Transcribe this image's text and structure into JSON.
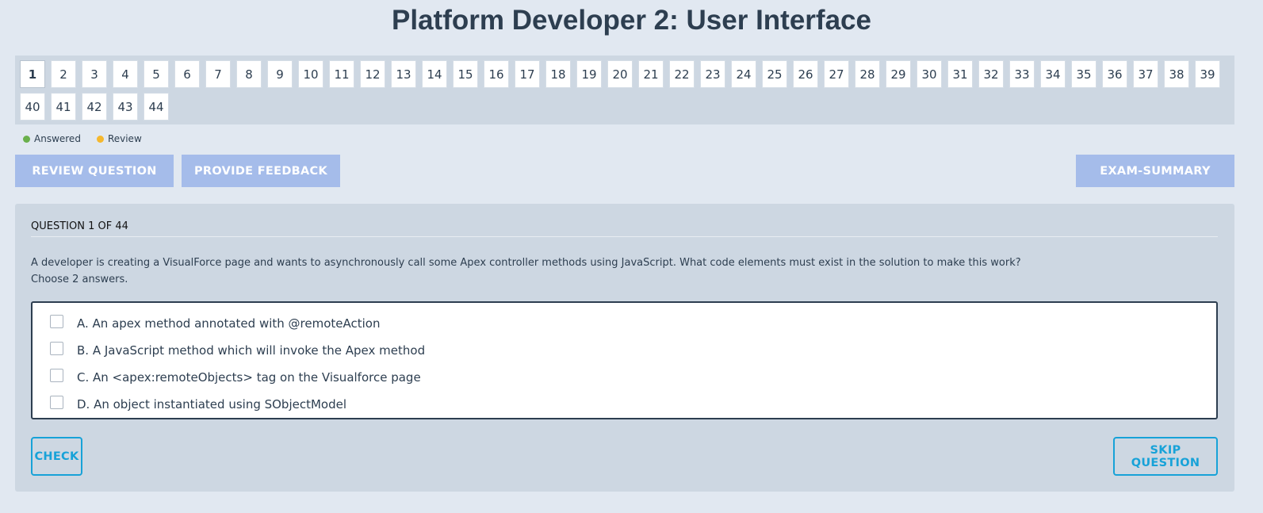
{
  "header": {
    "title": "Platform Developer 2: User Interface"
  },
  "navigation": {
    "current": "1",
    "questions": [
      "1",
      "2",
      "3",
      "4",
      "5",
      "6",
      "7",
      "8",
      "9",
      "10",
      "11",
      "12",
      "13",
      "14",
      "15",
      "16",
      "17",
      "18",
      "19",
      "20",
      "21",
      "22",
      "23",
      "24",
      "25",
      "26",
      "27",
      "28",
      "29",
      "30",
      "31",
      "32",
      "33",
      "34",
      "35",
      "36",
      "37",
      "38",
      "39",
      "40",
      "41",
      "42",
      "43",
      "44"
    ]
  },
  "legend": {
    "answered_label": "Answered",
    "answered_color": "#6ab04c",
    "review_label": "Review",
    "review_color": "#f5b82e"
  },
  "toolbar": {
    "review_label": "REVIEW QUESTION",
    "feedback_label": "PROVIDE FEEDBACK",
    "summary_label": "EXAM-SUMMARY"
  },
  "question": {
    "header": "QUESTION 1 OF 44",
    "text": "A developer is creating a VisualForce page and wants to asynchronously call some Apex controller methods using JavaScript. What code elements must exist in the solution to make this work?",
    "instruction": "Choose 2 answers.",
    "answers": [
      "A. An apex method annotated with @remoteAction",
      "B. A JavaScript method which will invoke the Apex method",
      "C. An <apex:remoteObjects> tag on the Visualforce page",
      "D. An object instantiated using SObjectModel"
    ]
  },
  "actions": {
    "check_label": "CHECK",
    "skip_label": "SKIP QUESTION"
  },
  "colors": {
    "background": "#e1e8f1",
    "panel": "#cdd7e2",
    "button_fill": "#a5bcea",
    "accent": "#17a2d8",
    "text": "#2d3e50"
  }
}
